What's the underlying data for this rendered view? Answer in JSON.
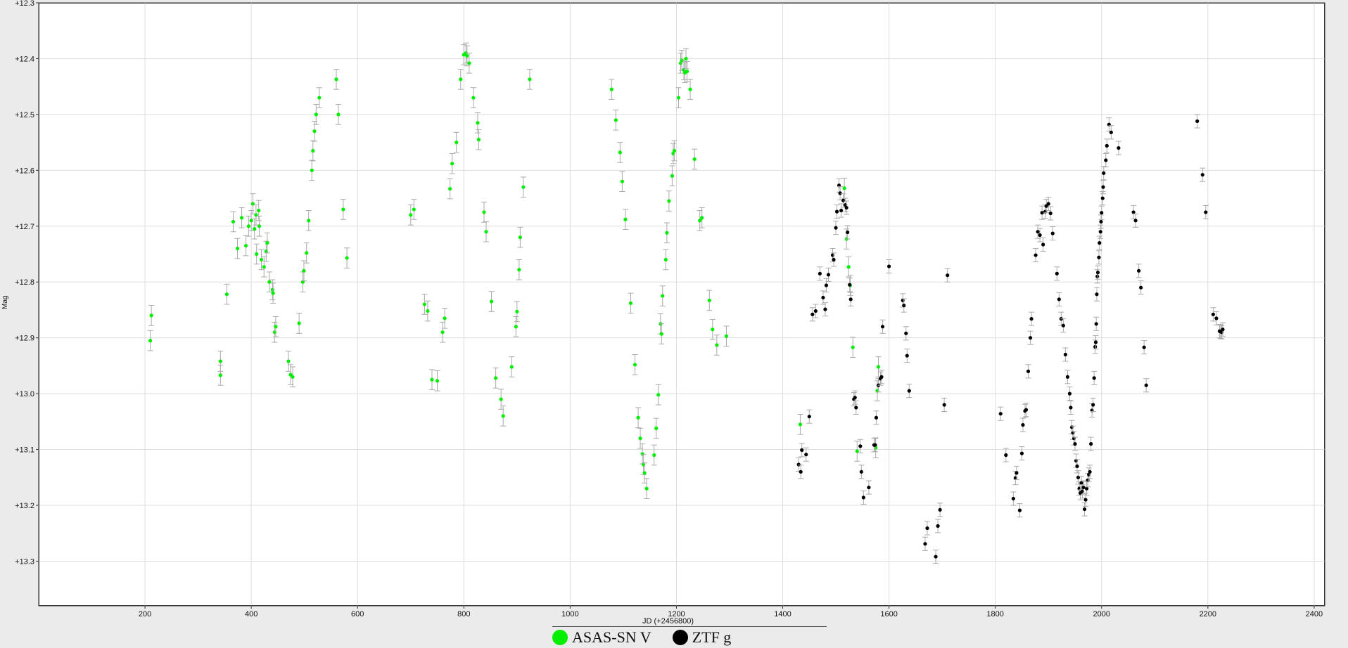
{
  "colors": {
    "asas": "#00ee00",
    "ztf": "#000000",
    "grid": "#dddddd",
    "error": "#aaaaaa"
  },
  "chart_data": {
    "type": "scatter",
    "xlabel": "JD (+2456800)",
    "ylabel": "Mag",
    "xlim": [
      0,
      2420
    ],
    "ylim": [
      12.3,
      13.38
    ],
    "y_inverted": true,
    "grid": true,
    "legend_position": "bottom-center",
    "x_ticks": [
      "200",
      "400",
      "600",
      "800",
      "1000",
      "1200",
      "1400",
      "1600",
      "1800",
      "2000",
      "2200",
      "2400"
    ],
    "y_ticks": [
      "+12.3",
      "+12.4",
      "+12.5",
      "+12.6",
      "+12.7",
      "+12.8",
      "+12.9",
      "+13.0",
      "+13.1",
      "+13.2",
      "+13.3"
    ],
    "series": [
      {
        "name": "ASAS-SN V",
        "color": "#00ee00",
        "error": 0.018,
        "points": [
          [
            210,
            12.905
          ],
          [
            212,
            12.86
          ],
          [
            342,
            12.942
          ],
          [
            342,
            12.967
          ],
          [
            354,
            12.822
          ],
          [
            366,
            12.692
          ],
          [
            374,
            12.74
          ],
          [
            382,
            12.685
          ],
          [
            390,
            12.735
          ],
          [
            395,
            12.7
          ],
          [
            400,
            12.69
          ],
          [
            403,
            12.66
          ],
          [
            406,
            12.705
          ],
          [
            409,
            12.68
          ],
          [
            410,
            12.75
          ],
          [
            414,
            12.672
          ],
          [
            415,
            12.7
          ],
          [
            419,
            12.76
          ],
          [
            424,
            12.773
          ],
          [
            428,
            12.745
          ],
          [
            430,
            12.73
          ],
          [
            434,
            12.8
          ],
          [
            440,
            12.814
          ],
          [
            441,
            12.82
          ],
          [
            444,
            12.89
          ],
          [
            446,
            12.88
          ],
          [
            470,
            12.942
          ],
          [
            474,
            12.966
          ],
          [
            478,
            12.97
          ],
          [
            490,
            12.874
          ],
          [
            497,
            12.8
          ],
          [
            499,
            12.78
          ],
          [
            504,
            12.748
          ],
          [
            508,
            12.69
          ],
          [
            514,
            12.6
          ],
          [
            516,
            12.565
          ],
          [
            519,
            12.53
          ],
          [
            522,
            12.5
          ],
          [
            528,
            12.47
          ],
          [
            560,
            12.437
          ],
          [
            564,
            12.5
          ],
          [
            573,
            12.67
          ],
          [
            580,
            12.757
          ],
          [
            700,
            12.68
          ],
          [
            706,
            12.67
          ],
          [
            726,
            12.84
          ],
          [
            732,
            12.852
          ],
          [
            740,
            12.975
          ],
          [
            750,
            12.977
          ],
          [
            760,
            12.89
          ],
          [
            764,
            12.865
          ],
          [
            774,
            12.633
          ],
          [
            778,
            12.588
          ],
          [
            786,
            12.55
          ],
          [
            794,
            12.437
          ],
          [
            800,
            12.393
          ],
          [
            804,
            12.39
          ],
          [
            806,
            12.395
          ],
          [
            810,
            12.408
          ],
          [
            818,
            12.47
          ],
          [
            826,
            12.515
          ],
          [
            828,
            12.545
          ],
          [
            838,
            12.675
          ],
          [
            842,
            12.71
          ],
          [
            852,
            12.835
          ],
          [
            860,
            12.972
          ],
          [
            870,
            13.01
          ],
          [
            874,
            13.04
          ],
          [
            890,
            12.952
          ],
          [
            898,
            12.88
          ],
          [
            900,
            12.853
          ],
          [
            904,
            12.778
          ],
          [
            906,
            12.72
          ],
          [
            912,
            12.63
          ],
          [
            924,
            12.437
          ],
          [
            1078,
            12.455
          ],
          [
            1086,
            12.51
          ],
          [
            1094,
            12.568
          ],
          [
            1098,
            12.62
          ],
          [
            1104,
            12.688
          ],
          [
            1114,
            12.838
          ],
          [
            1122,
            12.948
          ],
          [
            1128,
            13.043
          ],
          [
            1132,
            13.08
          ],
          [
            1136,
            13.108
          ],
          [
            1138,
            13.127
          ],
          [
            1140,
            13.142
          ],
          [
            1144,
            13.17
          ],
          [
            1158,
            13.11
          ],
          [
            1162,
            13.062
          ],
          [
            1166,
            13.002
          ],
          [
            1170,
            12.875
          ],
          [
            1172,
            12.893
          ],
          [
            1174,
            12.825
          ],
          [
            1180,
            12.76
          ],
          [
            1182,
            12.712
          ],
          [
            1186,
            12.655
          ],
          [
            1192,
            12.61
          ],
          [
            1194,
            12.57
          ],
          [
            1196,
            12.565
          ],
          [
            1204,
            12.47
          ],
          [
            1208,
            12.408
          ],
          [
            1210,
            12.403
          ],
          [
            1214,
            12.42
          ],
          [
            1216,
            12.425
          ],
          [
            1218,
            12.4
          ],
          [
            1220,
            12.423
          ],
          [
            1226,
            12.455
          ],
          [
            1234,
            12.58
          ],
          [
            1244,
            12.69
          ],
          [
            1248,
            12.685
          ],
          [
            1262,
            12.833
          ],
          [
            1268,
            12.885
          ],
          [
            1276,
            12.913
          ],
          [
            1294,
            12.897
          ],
          [
            1433,
            13.055
          ],
          [
            1516,
            12.632
          ],
          [
            1520,
            12.723
          ],
          [
            1524,
            12.773
          ],
          [
            1527,
            12.806
          ],
          [
            1532,
            12.917
          ],
          [
            1540,
            13.103
          ],
          [
            1575,
            13.097
          ],
          [
            1578,
            12.995
          ],
          [
            1580,
            12.952
          ]
        ]
      },
      {
        "name": "ZTF g",
        "color": "#000000",
        "error": 0.012,
        "points": [
          [
            1430,
            13.127
          ],
          [
            1434,
            13.14
          ],
          [
            1436,
            13.101
          ],
          [
            1444,
            13.109
          ],
          [
            1450,
            13.041
          ],
          [
            1456,
            12.858
          ],
          [
            1462,
            12.852
          ],
          [
            1470,
            12.785
          ],
          [
            1476,
            12.828
          ],
          [
            1480,
            12.849
          ],
          [
            1482,
            12.806
          ],
          [
            1486,
            12.787
          ],
          [
            1494,
            12.752
          ],
          [
            1496,
            12.76
          ],
          [
            1500,
            12.703
          ],
          [
            1502,
            12.674
          ],
          [
            1506,
            12.627
          ],
          [
            1508,
            12.641
          ],
          [
            1510,
            12.672
          ],
          [
            1514,
            12.654
          ],
          [
            1518,
            12.662
          ],
          [
            1520,
            12.667
          ],
          [
            1522,
            12.711
          ],
          [
            1526,
            12.805
          ],
          [
            1528,
            12.831
          ],
          [
            1534,
            13.01
          ],
          [
            1536,
            13.007
          ],
          [
            1538,
            13.025
          ],
          [
            1546,
            13.094
          ],
          [
            1548,
            13.14
          ],
          [
            1552,
            13.186
          ],
          [
            1562,
            13.168
          ],
          [
            1572,
            13.092
          ],
          [
            1574,
            13.092
          ],
          [
            1576,
            13.043
          ],
          [
            1580,
            12.985
          ],
          [
            1584,
            12.973
          ],
          [
            1586,
            12.97
          ],
          [
            1588,
            12.88
          ],
          [
            1600,
            12.772
          ],
          [
            1626,
            12.833
          ],
          [
            1628,
            12.842
          ],
          [
            1632,
            12.892
          ],
          [
            1634,
            12.932
          ],
          [
            1638,
            12.995
          ],
          [
            1668,
            13.269
          ],
          [
            1672,
            13.241
          ],
          [
            1688,
            13.292
          ],
          [
            1692,
            13.237
          ],
          [
            1696,
            13.208
          ],
          [
            1704,
            13.02
          ],
          [
            1710,
            12.788
          ],
          [
            1810,
            13.036
          ],
          [
            1820,
            13.11
          ],
          [
            1834,
            13.188
          ],
          [
            1838,
            13.151
          ],
          [
            1840,
            13.142
          ],
          [
            1846,
            13.209
          ],
          [
            1850,
            13.107
          ],
          [
            1852,
            13.056
          ],
          [
            1856,
            13.031
          ],
          [
            1858,
            13.029
          ],
          [
            1862,
            12.96
          ],
          [
            1866,
            12.9
          ],
          [
            1868,
            12.866
          ],
          [
            1876,
            12.752
          ],
          [
            1880,
            12.71
          ],
          [
            1884,
            12.716
          ],
          [
            1888,
            12.676
          ],
          [
            1890,
            12.733
          ],
          [
            1894,
            12.674
          ],
          [
            1896,
            12.664
          ],
          [
            1900,
            12.66
          ],
          [
            1904,
            12.677
          ],
          [
            1908,
            12.713
          ],
          [
            1916,
            12.785
          ],
          [
            1920,
            12.831
          ],
          [
            1924,
            12.866
          ],
          [
            1928,
            12.878
          ],
          [
            1932,
            12.93
          ],
          [
            1936,
            12.97
          ],
          [
            1940,
            13.0
          ],
          [
            1942,
            13.025
          ],
          [
            1944,
            13.06
          ],
          [
            1946,
            13.07
          ],
          [
            1948,
            13.08
          ],
          [
            1950,
            13.09
          ],
          [
            1952,
            13.12
          ],
          [
            1954,
            13.13
          ],
          [
            1956,
            13.15
          ],
          [
            1958,
            13.17
          ],
          [
            1960,
            13.178
          ],
          [
            1962,
            13.16
          ],
          [
            1964,
            13.175
          ],
          [
            1966,
            13.168
          ],
          [
            1968,
            13.207
          ],
          [
            1970,
            13.19
          ],
          [
            1972,
            13.17
          ],
          [
            1974,
            13.155
          ],
          [
            1976,
            13.145
          ],
          [
            1978,
            13.14
          ],
          [
            1980,
            13.09
          ],
          [
            1982,
            13.03
          ],
          [
            1984,
            13.02
          ],
          [
            1986,
            12.972
          ],
          [
            1988,
            12.916
          ],
          [
            1989,
            12.908
          ],
          [
            1990,
            12.875
          ],
          [
            1991,
            12.822
          ],
          [
            1992,
            12.79
          ],
          [
            1993,
            12.783
          ],
          [
            1995,
            12.756
          ],
          [
            1996,
            12.73
          ],
          [
            1998,
            12.71
          ],
          [
            1999,
            12.692
          ],
          [
            2000,
            12.676
          ],
          [
            2002,
            12.65
          ],
          [
            2003,
            12.63
          ],
          [
            2004,
            12.605
          ],
          [
            2008,
            12.582
          ],
          [
            2010,
            12.556
          ],
          [
            2014,
            12.518
          ],
          [
            2018,
            12.532
          ],
          [
            2032,
            12.56
          ],
          [
            2060,
            12.675
          ],
          [
            2064,
            12.69
          ],
          [
            2070,
            12.78
          ],
          [
            2074,
            12.81
          ],
          [
            2080,
            12.917
          ],
          [
            2084,
            12.985
          ],
          [
            2180,
            12.512
          ],
          [
            2190,
            12.608
          ],
          [
            2196,
            12.675
          ],
          [
            2210,
            12.858
          ],
          [
            2216,
            12.865
          ],
          [
            2222,
            12.888
          ],
          [
            2224,
            12.889
          ],
          [
            2226,
            12.89
          ],
          [
            2228,
            12.885
          ]
        ]
      }
    ]
  }
}
